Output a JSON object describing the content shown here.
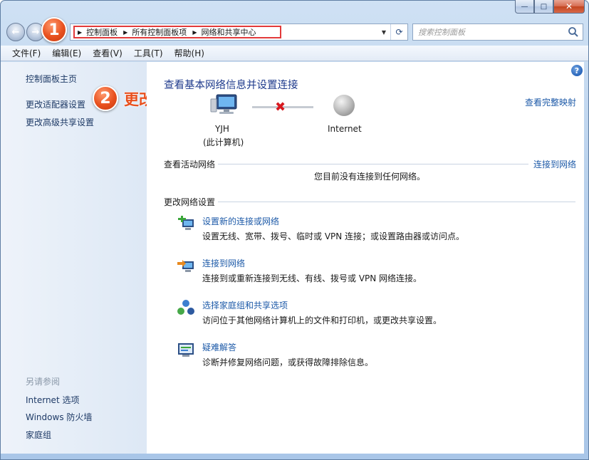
{
  "window": {
    "caption": {
      "minimize": "—",
      "maximize": "□",
      "close": "✕"
    },
    "colors": {
      "annotation": "#e8501e",
      "link": "#1d5aa8",
      "title": "#1e3a8c",
      "highlight_box": "#e23a3a"
    }
  },
  "nav": {
    "back_icon": "back-arrow-icon",
    "forward_icon": "forward-arrow-icon",
    "breadcrumbs": [
      "控制面板",
      "所有控制面板项",
      "网络和共享中心"
    ],
    "dropdown_glyph": "▼",
    "refresh_glyph": "⟳",
    "search_placeholder": "搜索控制面板"
  },
  "menu": {
    "items": [
      "文件(F)",
      "编辑(E)",
      "查看(V)",
      "工具(T)",
      "帮助(H)"
    ]
  },
  "sidebar": {
    "links": [
      "控制面板主页",
      "更改适配器设置",
      "更改高级共享设置"
    ],
    "see_also_heading": "另请参阅",
    "see_also": [
      "Internet 选项",
      "Windows 防火墙",
      "家庭组"
    ]
  },
  "main": {
    "help_glyph": "?",
    "title": "查看基本网络信息并设置连接",
    "full_map_link": "查看完整映射",
    "network_map": {
      "computer_name": "YJH",
      "computer_sub": "(此计算机)",
      "internet_label": "Internet",
      "status_glyph": "✖"
    },
    "active_networks": {
      "heading": "查看活动网络",
      "connect_link": "连接到网络",
      "status": "您目前没有连接到任何网络。"
    },
    "change_settings": {
      "heading": "更改网络设置",
      "tasks": [
        {
          "title": "设置新的连接或网络",
          "desc": "设置无线、宽带、拨号、临时或 VPN 连接；或设置路由器或访问点。",
          "icon": "new-connection-icon"
        },
        {
          "title": "连接到网络",
          "desc": "连接到或重新连接到无线、有线、拨号或 VPN 网络连接。",
          "icon": "connect-network-icon"
        },
        {
          "title": "选择家庭组和共享选项",
          "desc": "访问位于其他网络计算机上的文件和打印机，或更改共享设置。",
          "icon": "homegroup-icon"
        },
        {
          "title": "疑难解答",
          "desc": "诊断并修复网络问题，或获得故障排除信息。",
          "icon": "troubleshoot-icon"
        }
      ]
    }
  },
  "annotations": {
    "step1": "1",
    "step2": "2",
    "step2_text": "更改适配器"
  }
}
